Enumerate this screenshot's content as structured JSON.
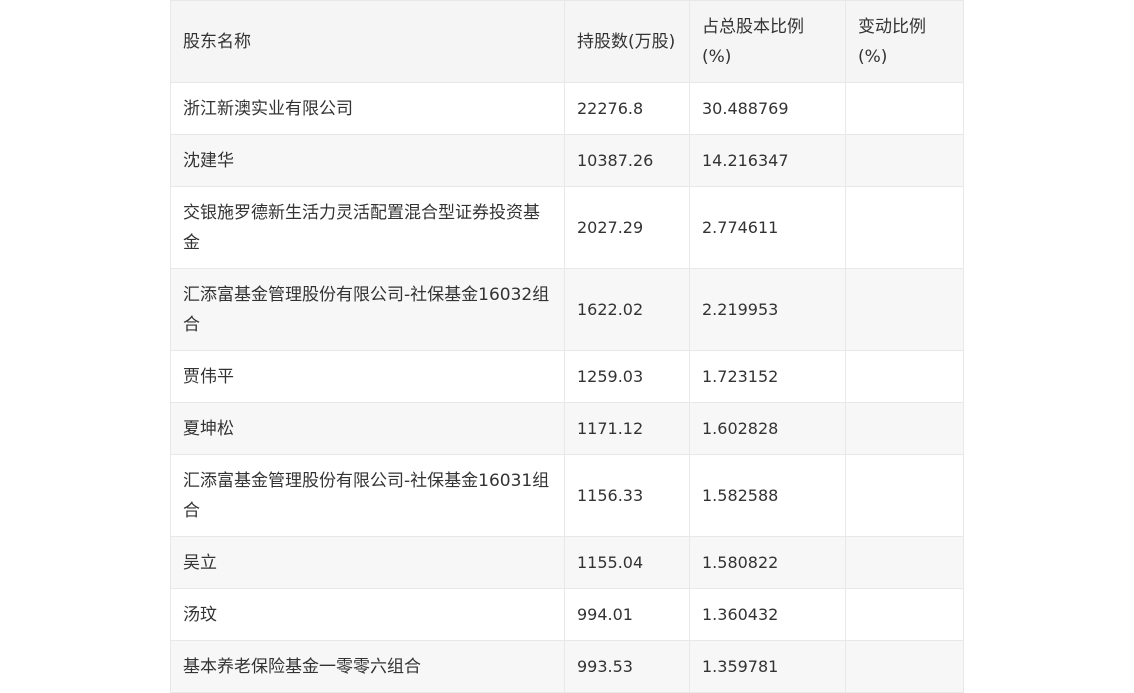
{
  "table": {
    "headers": [
      "股东名称",
      "持股数(万股)",
      "占总股本比例(%)",
      "变动比例(%)"
    ],
    "rows": [
      {
        "name": "浙江新澳实业有限公司",
        "shares": "22276.8",
        "ratio": "30.488769",
        "change": ""
      },
      {
        "name": "沈建华",
        "shares": "10387.26",
        "ratio": "14.216347",
        "change": ""
      },
      {
        "name": "交银施罗德新生活力灵活配置混合型证券投资基金",
        "shares": "2027.29",
        "ratio": "2.774611",
        "change": ""
      },
      {
        "name": "汇添富基金管理股份有限公司-社保基金16032组合",
        "shares": "1622.02",
        "ratio": "2.219953",
        "change": ""
      },
      {
        "name": "贾伟平",
        "shares": "1259.03",
        "ratio": "1.723152",
        "change": ""
      },
      {
        "name": "夏坤松",
        "shares": "1171.12",
        "ratio": "1.602828",
        "change": ""
      },
      {
        "name": "汇添富基金管理股份有限公司-社保基金16031组合",
        "shares": "1156.33",
        "ratio": "1.582588",
        "change": ""
      },
      {
        "name": "吴立",
        "shares": "1155.04",
        "ratio": "1.580822",
        "change": ""
      },
      {
        "name": "汤玟",
        "shares": "994.01",
        "ratio": "1.360432",
        "change": ""
      },
      {
        "name": "基本养老保险基金一零零六组合",
        "shares": "993.53",
        "ratio": "1.359781",
        "change": ""
      }
    ]
  }
}
